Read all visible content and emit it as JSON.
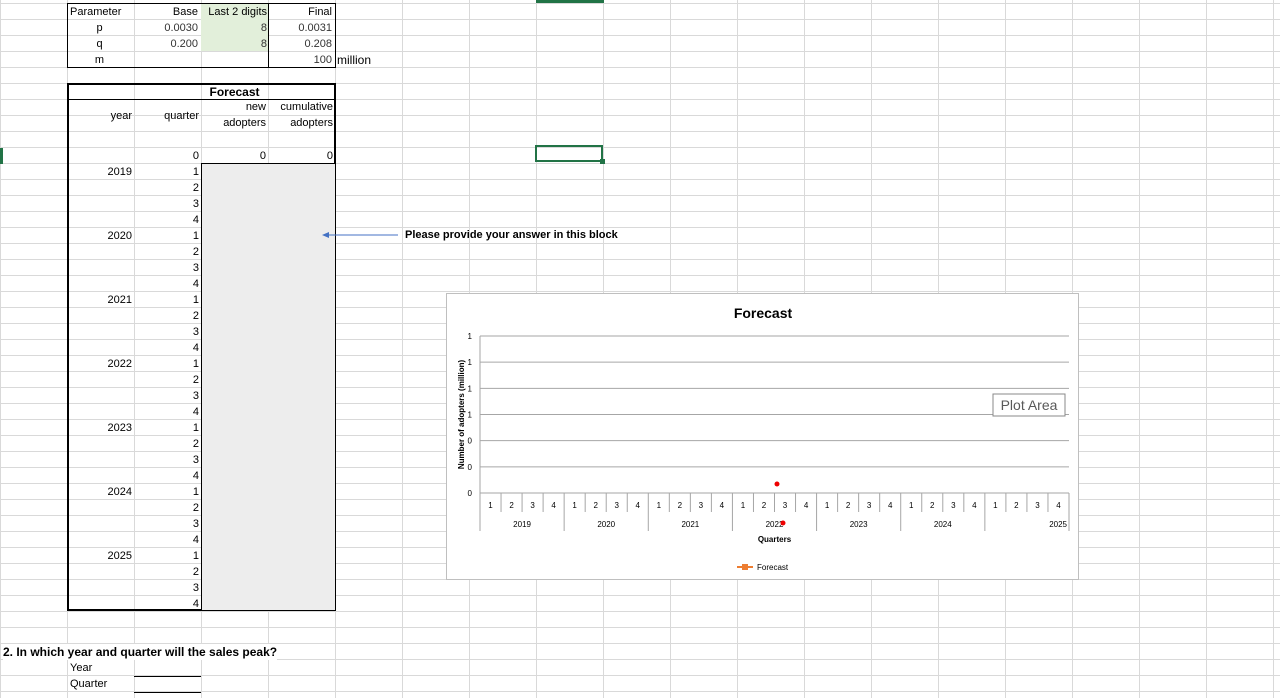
{
  "params": {
    "headers": [
      "Parameter",
      "Base",
      "Last 2 digits",
      "Final"
    ],
    "rows": [
      [
        "p",
        "0.0030",
        "8",
        "0.0031"
      ],
      [
        "q",
        "0.200",
        "8",
        "0.208"
      ],
      [
        "m",
        "",
        "",
        "100"
      ]
    ],
    "unit": "million"
  },
  "forecast": {
    "title": "Forecast",
    "col_year": "year",
    "col_quarter": "quarter",
    "col_new": "new adopters",
    "col_new_1": "new",
    "col_new_2": "adopters",
    "col_cum_1": "cumulative",
    "col_cum_2": "adopters",
    "initial": {
      "quarter": "0",
      "new": "0",
      "cum": "0"
    },
    "years": [
      "2019",
      "2020",
      "2021",
      "2022",
      "2023",
      "2024",
      "2025"
    ],
    "quarters": [
      "1",
      "2",
      "3",
      "4"
    ]
  },
  "note": "Please provide your answer in this block",
  "question": {
    "text": "2. In which year and quarter will the sales peak?",
    "year_label": "Year",
    "quarter_label": "Quarter"
  },
  "chart_data": {
    "type": "line",
    "title": "Forecast",
    "xlabel": "Quarters",
    "ylabel": "Number of adopters (million)",
    "y_tick_labels": [
      "0",
      "0",
      "0",
      "1",
      "1",
      "1",
      "1"
    ],
    "categories_years": [
      "2019",
      "2020",
      "2021",
      "2022",
      "2023",
      "2024",
      "2025"
    ],
    "categories_quarters": [
      "1",
      "2",
      "3",
      "4"
    ],
    "series": [
      {
        "name": "Forecast",
        "values": [],
        "color": "#ed7d31"
      }
    ],
    "grid": true,
    "legend": "bottom",
    "tooltip": "Plot Area"
  },
  "colors": {
    "input_fill": "#e2efda",
    "answer_fill": "#ededed",
    "arrow": "#4472c4",
    "selection": "#217346"
  }
}
